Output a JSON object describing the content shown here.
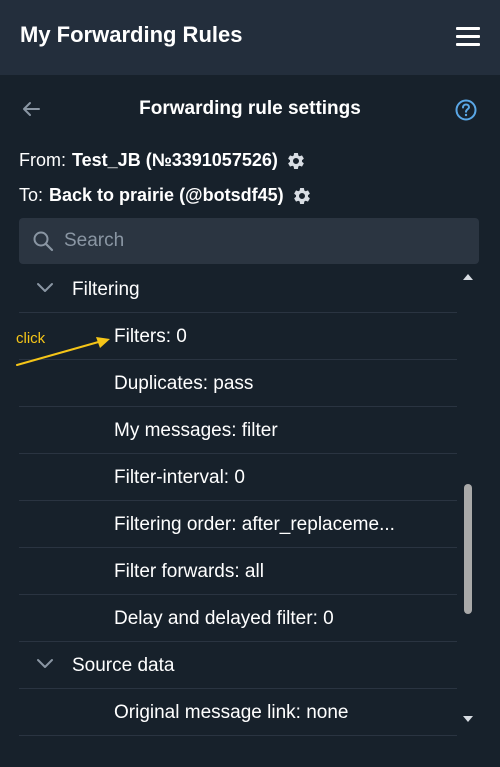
{
  "app": {
    "title": "My Forwarding Rules"
  },
  "header": {
    "title": "Forwarding rule settings"
  },
  "route": {
    "from_label": "From:",
    "from_value": "Test_JB (№3391057526)",
    "to_label": "To:",
    "to_value": "Back to prairie (@botsdf45)"
  },
  "search": {
    "placeholder": "Search"
  },
  "sections": [
    {
      "label": "Filtering",
      "items": [
        "Filters: 0",
        "Duplicates: pass",
        "My messages: filter",
        "Filter-interval: 0",
        "Filtering order: after_replaceme...",
        "Filter forwards: all",
        "Delay and delayed filter: 0"
      ]
    },
    {
      "label": "Source data",
      "items": [
        "Original message link: none"
      ]
    }
  ],
  "annotation": {
    "text": "click",
    "color": "#f5c518"
  },
  "colors": {
    "background": "#17212b",
    "topbar": "#232e3c",
    "search_bg": "#2b3541",
    "accent": "#5aa7e6"
  },
  "icons": {
    "menu": "hamburger-icon",
    "back": "arrow-left-icon",
    "help": "question-circle-icon",
    "settings": "gear-icon",
    "search": "search-icon",
    "expand": "chevron-down-icon"
  }
}
